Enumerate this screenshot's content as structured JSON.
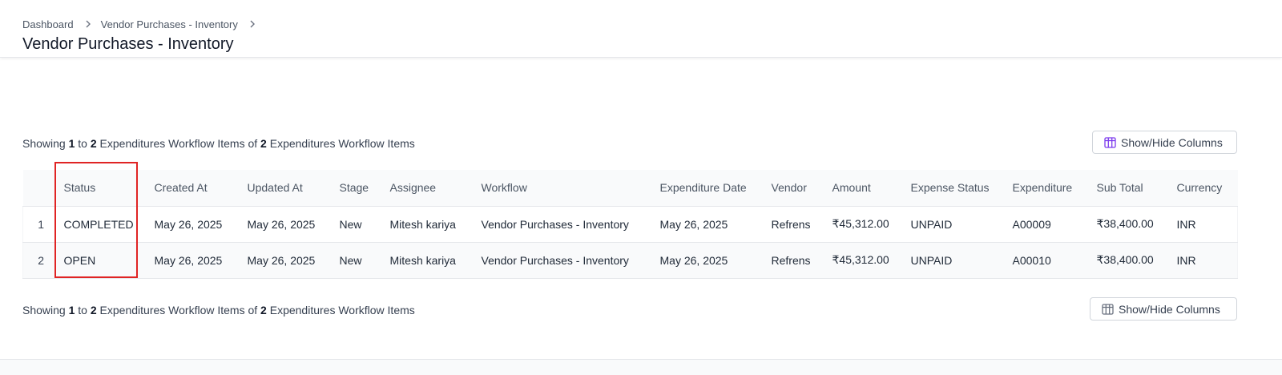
{
  "breadcrumb": {
    "items": [
      "Dashboard",
      "Vendor Purchases - Inventory"
    ],
    "separator": ">"
  },
  "page_title": "Vendor Purchases - Inventory",
  "summary": {
    "prefix": "Showing",
    "from": "1",
    "to_word": "to",
    "to": "2",
    "label": "Expenditures Workflow Items",
    "of_word": "of",
    "total": "2",
    "label2": "Expenditures Workflow Items"
  },
  "show_hide_label": "Show/Hide Columns",
  "table": {
    "columns": [
      "",
      "Status",
      "Created At",
      "Updated At",
      "Stage",
      "Assignee",
      "Workflow",
      "Expenditure Date",
      "Vendor",
      "Amount",
      "Expense Status",
      "Expenditure",
      "Sub Total",
      "Currency"
    ],
    "rows": [
      [
        "1",
        "COMPLETED",
        "May 26, 2025",
        "May 26, 2025",
        "New",
        "Mitesh kariya",
        "Vendor Purchases - Inventory",
        "May 26, 2025",
        "Refrens",
        "₹45,312.00",
        "UNPAID",
        "A00009",
        "₹38,400.00",
        "INR"
      ],
      [
        "2",
        "OPEN",
        "May 26, 2025",
        "May 26, 2025",
        "New",
        "Mitesh kariya",
        "Vendor Purchases - Inventory",
        "May 26, 2025",
        "Refrens",
        "₹45,312.00",
        "UNPAID",
        "A00010",
        "₹38,400.00",
        "INR"
      ]
    ]
  },
  "colors": {
    "highlight": "#e02424",
    "icon_accent": "#7c3aed"
  }
}
